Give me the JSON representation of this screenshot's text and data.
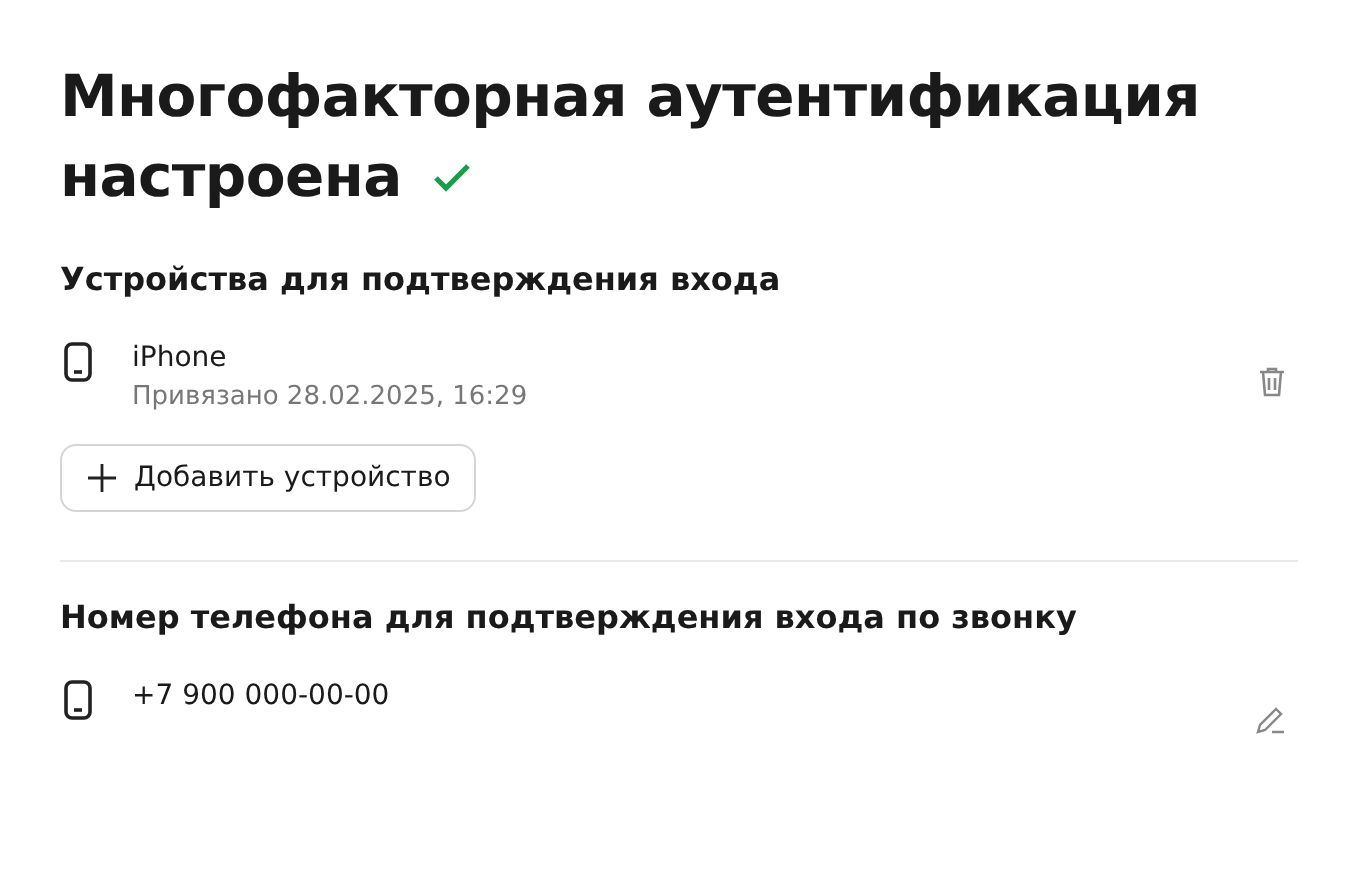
{
  "title": "Многофакторная аутентификация настроена",
  "configured": true,
  "devices_section": {
    "heading": "Устройства для подтверждения входа",
    "devices": [
      {
        "name": "iPhone",
        "linked": "Привязано 28.02.2025, 16:29"
      }
    ],
    "add_button": "Добавить устройство"
  },
  "phone_section": {
    "heading": "Номер телефона для подтверждения входа по звонку",
    "phone": "+7 900 000-00-00"
  }
}
